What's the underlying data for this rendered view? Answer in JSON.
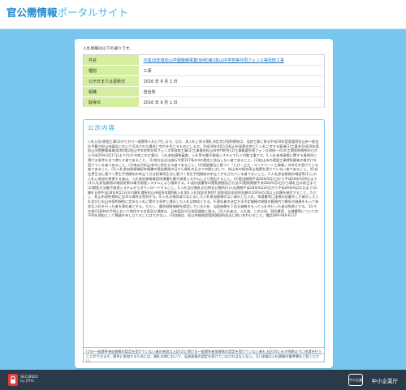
{
  "header": {
    "title_main": "官公需情報",
    "title_sub": "ポータルサイト"
  },
  "intro_text": "入札情報は以下の通りです。",
  "info_table": {
    "rows": [
      {
        "label": "件名",
        "value": "平成28年度松山学園整備事業(仮称)第2松山中学校等外周フェンス等改修工事"
      },
      {
        "label": "種別",
        "value": "工事"
      },
      {
        "label": "公示日または更新日",
        "value": "2016 年 9 月 1 日"
      },
      {
        "label": "組織",
        "value": "自治体"
      },
      {
        "label": "取得日",
        "value": "2016 年 9 月 1 日"
      }
    ]
  },
  "notice": {
    "title": "公示内容",
    "body": "入札公告(建設工事)次のとおり一般競争入札に付します。なお、本入札に係る落札決定及び契約締結は、当該工事に係る平成28年度愛媛県松山市一般会計予算が松山市議会において可決された場合に効力を生じるものとします。平成28年9月1日松山市長野志克仁1.入札に付する事項(1)工事名平成28年度松山学園整備事業(仮称)第2松山中学校等外周フェンス等改修工事(2)工事場所松山市井門町外(3)工事概要外周フェンス改修一式(4)工期契約締結の日から平成29年3月17日まで(5)その他この工事は、入札参加資格審査、入札等を電子調達システムで行う対象工事です。2.入札参加資格に関する事項次に掲げる条件を全て満たす者であること。(1)地方自治法施行令第167条の4の規定に該当しない者であること。(2)松山市の建設工事請負業者の格付けを受けている者であること。(3)本店が松山市内に所在する者であること。(4)建設業法に基づく「とび・土工・コンクリート工事業」の許可を受けている者であること。(5)入札参加資格確認申請書の提出期限の日から開札の日までの間において、松山市の指名停止措置を受けていない者であること。(6)会社更生法に基づく更生手続開始の申立て又は民事再生法に基づく再生手続開始の申立てがなされている者でないこと。3.入札参加資格の確認等(1)この入札に参加を希望する者は、入札参加資格確認申請書を電子調達システムにより提出すること。(2)提出期間平成28年9月1日から平成28年9月9日まで(3)入札参加資格の確認結果は電子調達システムにより通知する。4.設計図書等の閲覧期間及び方法(1)閲覧期間平成28年9月1日から開札日の前日まで(2)閲覧方法電子調達システムからダウンロードすること。5.入札及び開札の日時及び場所(1)入札期間平成28年9月20日から平成28年9月21日まで(2)開札日時平成28年9月23日(3)開札場所松山市役所本館6階入札室6.入札保証金免除7.契約保証金契約金額の100分の10以上の額を納付すること。ただし、松山市契約規則に定める場合は免除する。8.入札の無効本公告に示した入札参加資格のない者のした入札、申請書等に虚偽の記載をした者のした入札並びに松山市契約規則に定める入札に関する条件に違反した入札は無効とする。9.落札者の決定方法予定価格の制限の範囲内で最低の価格をもって有効な入札を行った者を落札者とする。ただし、最低制限価格を設定しているため、当該価格を下回る価格をもって入札を行った者は失格とする。10.その他(1)契約の手続において使用する言語及び通貨は、日本語及び日本国通貨に限る。(2)入札者は、入札後、この公告、契約書案、仕様書等についての不明を理由として異議を申し立てることはできない。(3)詳細は、松山市総務部管財課契約担当に問い合わせること。電話089-948-6237"
  },
  "bottom_note": "(1)ひ一般競争参加資格の認定を受けていない者の参加は上記(2)に掲げる一般競争参加資格の認定を受けていない者も上記(3)に示す時期までに申請を行うことができます。競争に参加するためには、開札の時において、当該資格の認定を受けていなければならない。(1) 詳細は入札情報の備考欄をご覧ください。",
  "footer": {
    "secured_line1": "SECURED",
    "secured_line2": "by JPRS",
    "sme_badge": "中小企業庁",
    "sme_name": "中小企業庁"
  },
  "colors": {
    "brand_blue": "#1f88cc",
    "background": "#4fb3e6",
    "label_bg": "#d5eea0",
    "footer_bg": "#2a3a48"
  }
}
